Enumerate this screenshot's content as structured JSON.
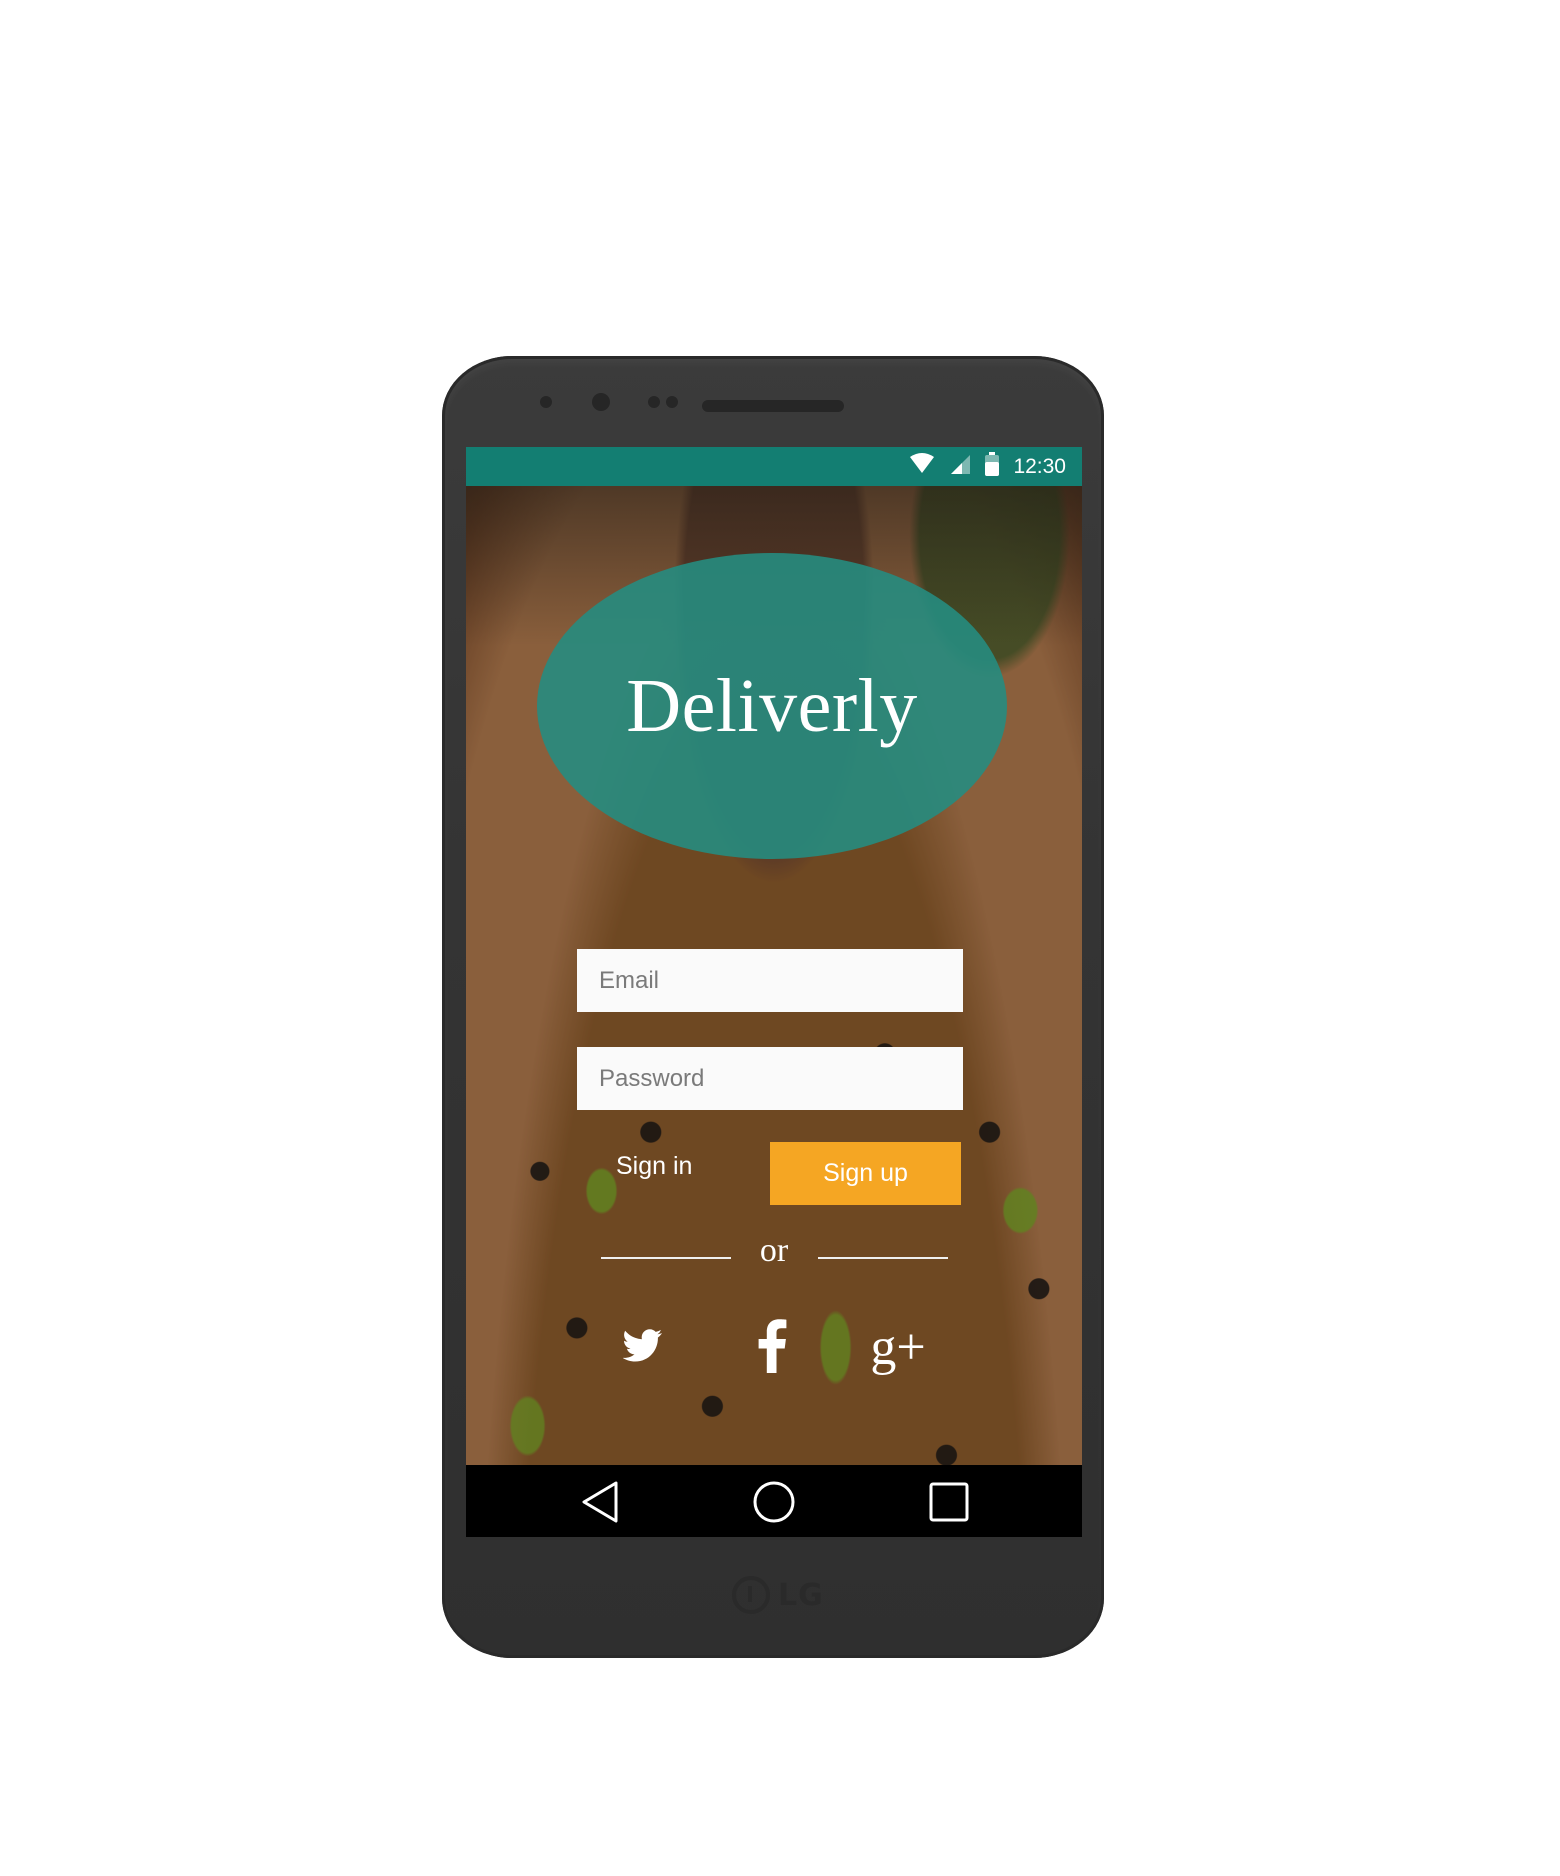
{
  "status_bar": {
    "time": "12:30",
    "icons": [
      "wifi-icon",
      "cellular-signal-icon",
      "battery-icon"
    ],
    "color": "#137e72"
  },
  "app": {
    "title": "Deliverly",
    "logo_color": "#268c80",
    "email_placeholder": "Email",
    "password_placeholder": "Password",
    "signin_label": "Sign in",
    "signup_label": "Sign up",
    "signup_color": "#f5a623",
    "divider_text": "or",
    "social": [
      "twitter-icon",
      "facebook-icon",
      "google-plus-icon"
    ],
    "google_plus_label": "g+"
  },
  "nav_bar": {
    "buttons": [
      "back-icon",
      "home-icon",
      "recent-apps-icon"
    ]
  },
  "device": {
    "brand": "LG"
  }
}
